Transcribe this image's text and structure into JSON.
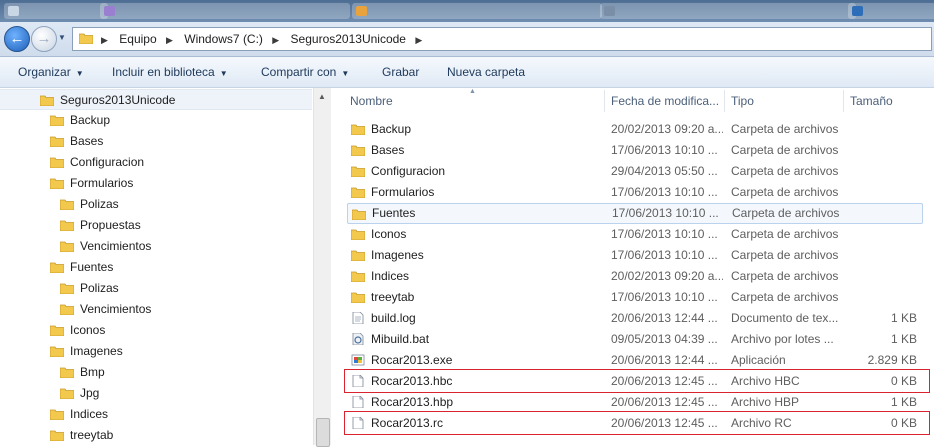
{
  "nav": {
    "breadcrumbs": [
      "Equipo",
      "Windows7 (C:)",
      "Seguros2013Unicode"
    ]
  },
  "toolbar": {
    "organize": "Organizar",
    "include_library": "Incluir en biblioteca",
    "share": "Compartir con",
    "burn": "Grabar",
    "new_folder": "Nueva carpeta"
  },
  "tree": {
    "root": "Seguros2013Unicode",
    "items": [
      {
        "label": "Backup",
        "level": 1
      },
      {
        "label": "Bases",
        "level": 1
      },
      {
        "label": "Configuracion",
        "level": 1
      },
      {
        "label": "Formularios",
        "level": 1
      },
      {
        "label": "Polizas",
        "level": 2
      },
      {
        "label": "Propuestas",
        "level": 2
      },
      {
        "label": "Vencimientos",
        "level": 2
      },
      {
        "label": "Fuentes",
        "level": 1
      },
      {
        "label": "Polizas",
        "level": 2
      },
      {
        "label": "Vencimientos",
        "level": 2
      },
      {
        "label": "Iconos",
        "level": 1
      },
      {
        "label": "Imagenes",
        "level": 1
      },
      {
        "label": "Bmp",
        "level": 2
      },
      {
        "label": "Jpg",
        "level": 2
      },
      {
        "label": "Indices",
        "level": 1
      },
      {
        "label": "treeytab",
        "level": 1
      }
    ]
  },
  "columns": {
    "name": "Nombre",
    "date": "Fecha de modifica...",
    "type": "Tipo",
    "size": "Tamaño"
  },
  "files": [
    {
      "name": "Backup",
      "date": "20/02/2013 09:20 a...",
      "type": "Carpeta de archivos",
      "size": "",
      "icon": "folder-icon"
    },
    {
      "name": "Bases",
      "date": "17/06/2013 10:10 ...",
      "type": "Carpeta de archivos",
      "size": "",
      "icon": "folder-icon"
    },
    {
      "name": "Configuracion",
      "date": "29/04/2013 05:50 ...",
      "type": "Carpeta de archivos",
      "size": "",
      "icon": "folder-icon"
    },
    {
      "name": "Formularios",
      "date": "17/06/2013 10:10 ...",
      "type": "Carpeta de archivos",
      "size": "",
      "icon": "folder-icon"
    },
    {
      "name": "Fuentes",
      "date": "17/06/2013 10:10 ...",
      "type": "Carpeta de archivos",
      "size": "",
      "icon": "folder-icon",
      "selected": true
    },
    {
      "name": "Iconos",
      "date": "17/06/2013 10:10 ...",
      "type": "Carpeta de archivos",
      "size": "",
      "icon": "folder-icon"
    },
    {
      "name": "Imagenes",
      "date": "17/06/2013 10:10 ...",
      "type": "Carpeta de archivos",
      "size": "",
      "icon": "folder-icon"
    },
    {
      "name": "Indices",
      "date": "20/02/2013 09:20 a...",
      "type": "Carpeta de archivos",
      "size": "",
      "icon": "folder-icon"
    },
    {
      "name": "treeytab",
      "date": "17/06/2013 10:10 ...",
      "type": "Carpeta de archivos",
      "size": "",
      "icon": "folder-icon"
    },
    {
      "name": "build.log",
      "date": "20/06/2013 12:44 ...",
      "type": "Documento de tex...",
      "size": "1 KB",
      "icon": "text-file-icon"
    },
    {
      "name": "Mibuild.bat",
      "date": "09/05/2013 04:39 ...",
      "type": "Archivo por lotes ...",
      "size": "1 KB",
      "icon": "batch-file-icon"
    },
    {
      "name": "Rocar2013.exe",
      "date": "20/06/2013 12:44 ...",
      "type": "Aplicación",
      "size": "2.829 KB",
      "icon": "application-icon"
    },
    {
      "name": "Rocar2013.hbc",
      "date": "20/06/2013 12:45 ...",
      "type": "Archivo HBC",
      "size": "0 KB",
      "icon": "generic-file-icon",
      "highlighted": true
    },
    {
      "name": "Rocar2013.hbp",
      "date": "20/06/2013 12:45 ...",
      "type": "Archivo HBP",
      "size": "1 KB",
      "icon": "generic-file-icon"
    },
    {
      "name": "Rocar2013.rc",
      "date": "20/06/2013 12:45 ...",
      "type": "Archivo RC",
      "size": "0 KB",
      "icon": "generic-file-icon",
      "highlighted": true
    }
  ],
  "colors": {
    "highlight_border": "#d9232f",
    "selection_border": "#b9d2ee",
    "folder_yellow": "#f2c94c"
  }
}
